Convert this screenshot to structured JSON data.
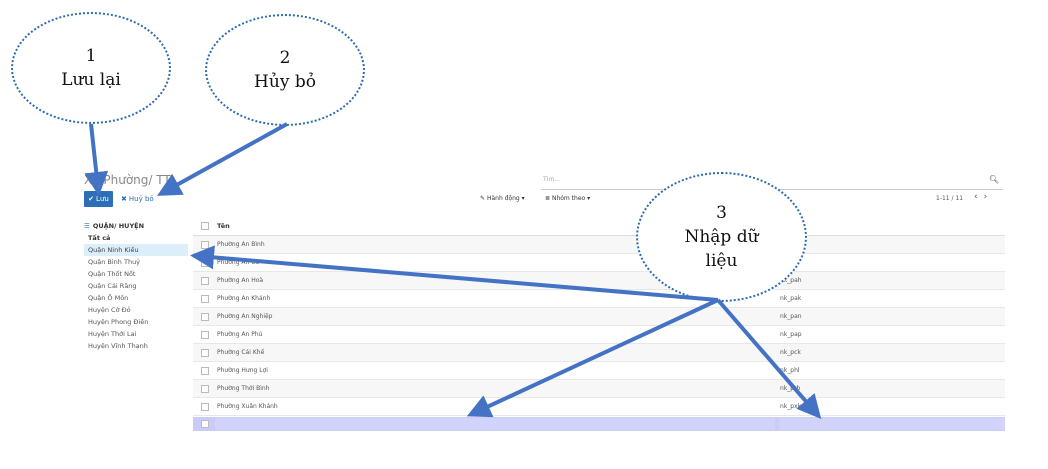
{
  "annotations": [
    {
      "number": "1",
      "label": "Lưu lại"
    },
    {
      "number": "2",
      "label": "Hủy bỏ"
    },
    {
      "number": "3",
      "label_line1": "Nhập dữ",
      "label_line2": "liệu"
    }
  ],
  "header": {
    "breadcrumb": "Xã Phường/ TT"
  },
  "toolbar": {
    "save_label": "Lưu",
    "cancel_label": "Huỷ bỏ",
    "action_label": "Hành động",
    "group_label": "Nhóm theo",
    "pager": "1-11 / 11"
  },
  "search": {
    "placeholder": "Tìm..."
  },
  "sidebar": {
    "title": "QUẬN/ HUYỆN",
    "all_label": "Tất cả",
    "items": [
      "Quận Ninh Kiều",
      "Quận Bình Thuỷ",
      "Quận Thốt Nốt",
      "Quận Cái Răng",
      "Quận Ô Môn",
      "Huyện Cờ Đỏ",
      "Huyện Phong Điền",
      "Huyện Thới Lai",
      "Huyện Vĩnh Thạnh"
    ]
  },
  "table": {
    "header": "Tên",
    "rows": [
      {
        "name": "Phường An Bình",
        "code": ""
      },
      {
        "name": "Phường An Cư",
        "code": ""
      },
      {
        "name": "Phường An Hoà",
        "code": "nk_pah"
      },
      {
        "name": "Phường An Khánh",
        "code": "nk_pak"
      },
      {
        "name": "Phường An Nghiệp",
        "code": "nk_pan"
      },
      {
        "name": "Phường An Phú",
        "code": "nk_pap"
      },
      {
        "name": "Phường Cái Khế",
        "code": "nk_pck"
      },
      {
        "name": "Phường Hưng Lợi",
        "code": "nk_phl"
      },
      {
        "name": "Phường Thới Bình",
        "code": "nk_ptb"
      },
      {
        "name": "Phường Xuân Khánh",
        "code": "nk_pxk"
      }
    ]
  },
  "colors": {
    "accent": "#2d6fb7",
    "arrow": "#4472c4",
    "edit_row": "#c9cbf8",
    "active_item": "#dbeefa"
  }
}
